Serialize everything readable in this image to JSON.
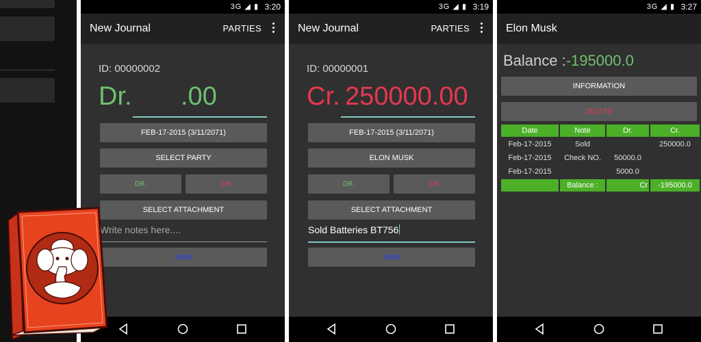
{
  "colors": {
    "dr_green": "#6fc16f",
    "cr_red": "#e8384f",
    "save_blue": "#1e3cff",
    "table_green": "#4caf28",
    "accent_teal": "#80cbc4",
    "logo_orange": "#e8431f"
  },
  "phones": [
    {
      "status": {
        "network": "3G",
        "time": "3:20"
      },
      "title": "New Journal",
      "action": "PARTIES",
      "id_label": "ID: 00000002",
      "amount_type": "Dr.",
      "amount_value": ".00",
      "date_button": "FEB-17-2015 (3/11/2071)",
      "party_button": "SELECT PARTY",
      "dr_button": "DR.",
      "cr_button": "CR.",
      "attachment_button": "SELECT ATTACHMENT",
      "notes_placeholder": "Write notes here....",
      "notes_value": "",
      "save_button": "SAVE"
    },
    {
      "status": {
        "network": "3G",
        "time": "3:19"
      },
      "title": "New Journal",
      "action": "PARTIES",
      "id_label": "ID: 00000001",
      "amount_type": "Cr.",
      "amount_value": "250000.00",
      "date_button": "FEB-17-2015 (3/11/2071)",
      "party_button": "ELON MUSK",
      "dr_button": "DR.",
      "cr_button": "CR.",
      "attachment_button": "SELECT ATTACHMENT",
      "notes_placeholder": "",
      "notes_value": "Sold Batteries BT756",
      "save_button": "SAVE"
    }
  ],
  "ledger": {
    "status": {
      "network": "3G",
      "time": "3:27"
    },
    "title": "Elon Musk",
    "balance_label": "Balance :",
    "balance_value": "-195000.0",
    "information_button": "INFORMATION",
    "delete_button": "DELETE",
    "headers": [
      "Date",
      "Note",
      "Dr.",
      "Cr."
    ],
    "rows": [
      [
        "Feb-17-2015",
        "Sold",
        "",
        "250000.0"
      ],
      [
        "Feb-17-2015",
        "Check NO.",
        "50000.0",
        ""
      ],
      [
        "Feb-17-2015",
        "",
        "5000.0",
        ""
      ]
    ],
    "footer": [
      "",
      "Balance :",
      "Cr",
      "-195000.0"
    ]
  }
}
